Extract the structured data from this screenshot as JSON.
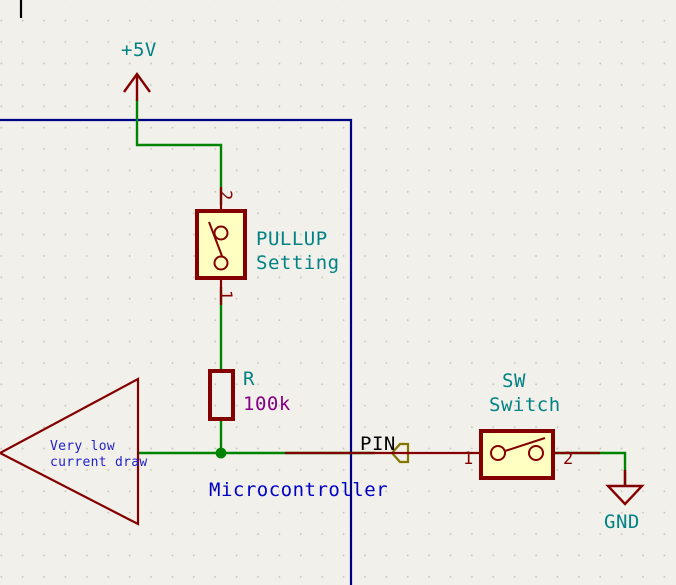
{
  "schematic": {
    "title": "Pull-up switch schematic",
    "colors": {
      "background": "#f1f0ea",
      "grid_dot": "#c9c7bd",
      "wire_green": "#008400",
      "component_outline": "#840000",
      "component_fill": "#ffffc2",
      "sheet_blue": "#000084",
      "label_teal": "#008284",
      "label_purple": "#840084",
      "label_blue": "#0000c4",
      "pin_arrow_olive": "#847400",
      "note_text_blue": "#2222cc",
      "cursor_black": "#000000"
    },
    "power_symbols": [
      {
        "name": "plus-5v",
        "label": "+5V"
      },
      {
        "name": "gnd",
        "label": "GND"
      }
    ],
    "components": [
      {
        "name": "pullup-switch",
        "reference": "PULLUP",
        "value": "Setting",
        "pins": [
          {
            "number": "2",
            "position": "top"
          },
          {
            "number": "1",
            "position": "bottom"
          }
        ]
      },
      {
        "name": "resistor",
        "reference": "R",
        "value": "100k"
      },
      {
        "name": "sw-switch",
        "reference": "SW",
        "value": "Switch",
        "pins": [
          {
            "number": "1",
            "position": "left"
          },
          {
            "number": "2",
            "position": "right"
          }
        ]
      }
    ],
    "net_labels": [
      {
        "name": "pin-label",
        "text": "PIN"
      }
    ],
    "sheet_labels": [
      {
        "name": "microcontroller-sheet",
        "text": "Microcontroller"
      }
    ],
    "annotations": [
      {
        "name": "current-draw-note",
        "line1": "Very low",
        "line2": "current draw"
      }
    ]
  }
}
